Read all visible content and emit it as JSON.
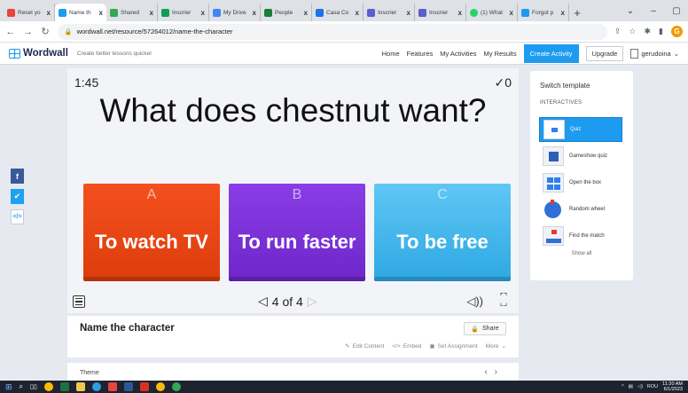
{
  "browser": {
    "tabs": [
      {
        "title": "Reset yo",
        "color": "#e8453c"
      },
      {
        "title": "Name th",
        "color": "#1d9bf0",
        "active": true
      },
      {
        "title": "Shared",
        "color": "#34a853"
      },
      {
        "title": "Inscrier",
        "color": "#0f9d58"
      },
      {
        "title": "My Drive",
        "color": "#4285f4"
      },
      {
        "title": "People",
        "color": "#188038"
      },
      {
        "title": "Casa Co",
        "color": "#1a73e8"
      },
      {
        "title": "Inscrier",
        "color": "#5b5fc7"
      },
      {
        "title": "Inscrier",
        "color": "#5b5fc7"
      },
      {
        "title": "(1) What",
        "color": "#25d366"
      },
      {
        "title": "Forgot p",
        "color": "#1d9bf0"
      }
    ],
    "close_glyph": "x",
    "new_tab": "+",
    "url": "wordwall.net/resource/57264012/name-the-character",
    "window_controls": {
      "minimize": "–",
      "maximize": "▢",
      "close": "✕"
    }
  },
  "header": {
    "logo_text": "Wordwall",
    "tagline": "Create better lessons quicker",
    "nav": [
      "Home",
      "Features",
      "My Activities",
      "My Results"
    ],
    "create_label": "Create Activity",
    "upgrade_label": "Upgrade",
    "username": "gerudoina"
  },
  "activity": {
    "timer": "1:45",
    "score": "0",
    "question": "What does chestnut want?",
    "answers": [
      {
        "letter": "A",
        "text": "To watch TV"
      },
      {
        "letter": "B",
        "text": "To run faster"
      },
      {
        "letter": "C",
        "text": "To be free"
      }
    ],
    "pager": "4 of 4"
  },
  "info": {
    "title": "Name the character",
    "share_label": "Share",
    "links": [
      "Edit Content",
      "Embed",
      "Set Assignment",
      "More"
    ],
    "theme_label": "Theme"
  },
  "switch_template": {
    "title": "Switch template",
    "section": "INTERACTIVES",
    "templates": [
      "Quiz",
      "Gameshow quiz",
      "Open the box",
      "Random wheel",
      "Find the match"
    ],
    "show_all": "Show all"
  },
  "taskbar": {
    "language": "ROU",
    "time": "11:20 AM",
    "date": "6/1/2023"
  }
}
